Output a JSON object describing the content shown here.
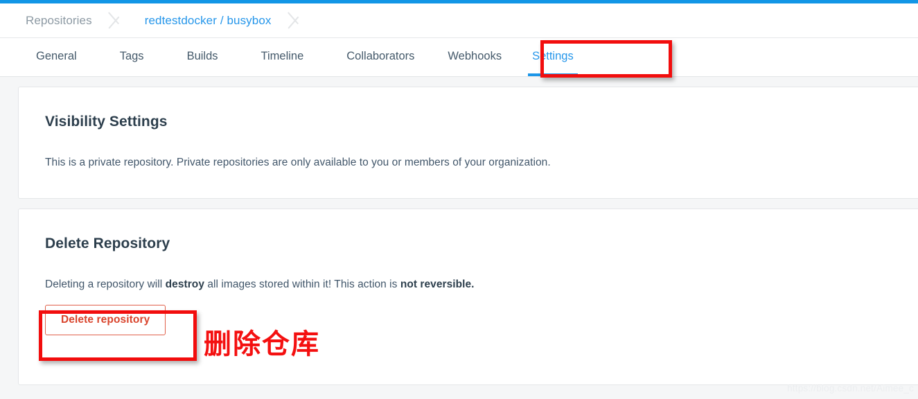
{
  "theme": {
    "accent_blue": "#1296e6",
    "link_blue": "#2596ea",
    "tab_text": "#44596a",
    "annotation_red": "#f20d0d",
    "danger_red": "#d9442c",
    "page_background": "#f5f6f7",
    "card_background": "#ffffff"
  },
  "breadcrumb": {
    "items": [
      {
        "label": "Repositories",
        "active": false
      },
      {
        "label": "redtestdocker / busybox",
        "active": true
      }
    ]
  },
  "tabs": [
    {
      "id": "general",
      "label": "General",
      "active": false
    },
    {
      "id": "tags",
      "label": "Tags",
      "active": false
    },
    {
      "id": "builds",
      "label": "Builds",
      "active": false
    },
    {
      "id": "timeline",
      "label": "Timeline",
      "active": false
    },
    {
      "id": "collaborators",
      "label": "Collaborators",
      "active": false
    },
    {
      "id": "webhooks",
      "label": "Webhooks",
      "active": false
    },
    {
      "id": "settings",
      "label": "Settings",
      "active": true
    }
  ],
  "cards": {
    "visibility": {
      "title": "Visibility Settings",
      "body": "This is a private repository. Private repositories are only available to you or members of your organization."
    },
    "delete": {
      "title": "Delete Repository",
      "body_part_1": "Deleting a repository will ",
      "body_bold_1": "destroy",
      "body_part_2": " all images stored within it! This action is ",
      "body_bold_2": "not reversible.",
      "button_label": "Delete repository"
    }
  },
  "annotations": {
    "chinese_note": "删除仓库"
  },
  "watermark": {
    "text": "https://blog.csdn.net/Aimee_c"
  }
}
